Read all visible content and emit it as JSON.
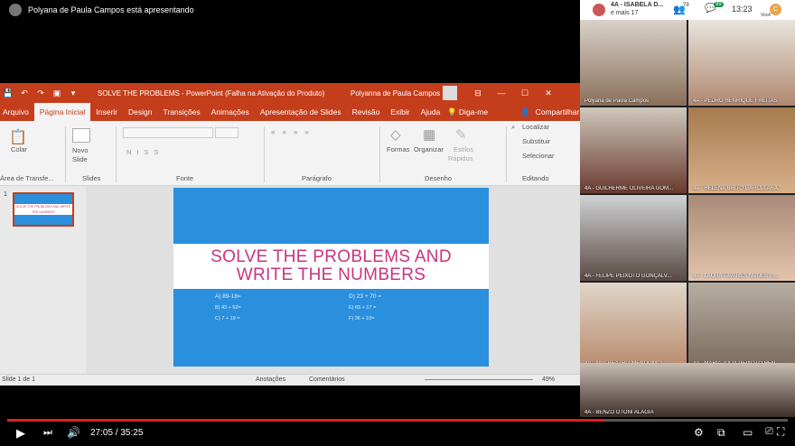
{
  "top": {
    "presenter_text": "Polyana de Paula Campos está apresentando"
  },
  "meet": {
    "room": "4A - ISABELA D...",
    "more": "e mais 17",
    "people_count": "79",
    "chat_count": "99",
    "time": "13:23",
    "you": "Você"
  },
  "pp": {
    "title": "SOLVE THE PROBLEMS  -  PowerPoint (Falha na Ativação do Produto)",
    "user": "Polyanna de Paula Campos",
    "tabs": [
      "Arquivo",
      "Página Inicial",
      "Inserir",
      "Design",
      "Transições",
      "Animações",
      "Apresentação de Slides",
      "Revisão",
      "Exibir",
      "Ajuda"
    ],
    "tell": "Diga-me",
    "share": "Compartilhar",
    "groups": {
      "clip": "Área de Transfe...",
      "slides": "Slides",
      "font": "Fonte",
      "para": "Parágrafo",
      "draw": "Desenho",
      "edit": "Editando"
    },
    "ribbon": {
      "copy": "Colar",
      "new_slide": "Novo",
      "new_slide2": "Slide",
      "forms": "Formas",
      "organize": "Organizar",
      "styles": "Estilos",
      "styles2": "Rápidos",
      "find": "Localizar",
      "replace": "Substituir",
      "select": "Selecionar"
    },
    "slide": {
      "line1": "SOLVE THE PROBLEMS AND",
      "line2": "WRITE THE NUMBERS",
      "problems": [
        "A)  89-18=",
        "B)  43 + 52=",
        "C)  7 + 19 =",
        "D) 23 + 70 =",
        "E) 65 + 17 =",
        "F) 36 + 10="
      ]
    },
    "thumb_num": "1",
    "thumb_text": "SOLVE THE PROBLEMS AND WRITE THE NUMBERS",
    "status": {
      "slide": "Slide 1 de 1",
      "notes": "Anotações",
      "comments": "Comentários",
      "zoom": "49%"
    }
  },
  "participants": [
    "Polyana de Paula Campos",
    "4A - PEDRO HENRIQUE FREITAS",
    "4A - GUILHERME OLIVEIRA GOM...",
    "4A - HELENA BRITO GARCIA ARA...",
    "4A - FELIPE PEIXOTO GONÇALV...",
    "4A - LAURA TAVARES NUNES (m...",
    "4A - ANA BEATRIZ MENDONÇA ...",
    "4A - MARIA JULIA PEIXOTO HEN...",
    "4A - BENZO OTONI ALÁGIA"
  ],
  "player": {
    "time": "27:05 / 35:25",
    "progress": 0.7645
  }
}
